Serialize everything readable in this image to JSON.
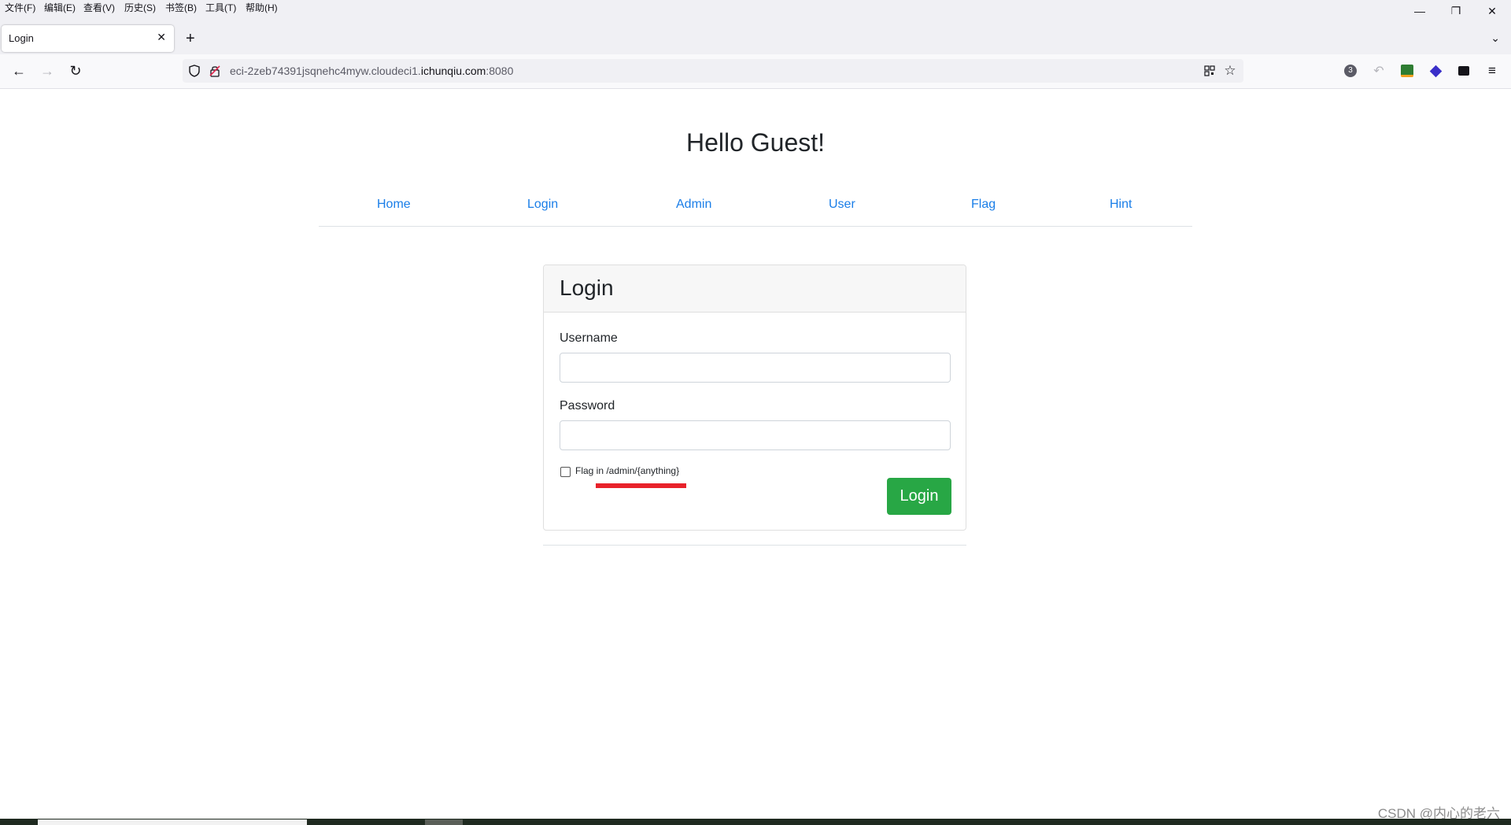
{
  "menubar": {
    "items": [
      "文件(F)",
      "编辑(E)",
      "查看(V)",
      "历史(S)",
      "书签(B)",
      "工具(T)",
      "帮助(H)"
    ]
  },
  "window_controls": {
    "minimize": "—",
    "restore": "❐",
    "close": "✕"
  },
  "tab": {
    "title": "Login",
    "close": "✕",
    "new_tab": "+",
    "list_tabs": "⌄"
  },
  "navigation": {
    "back": "←",
    "forward": "→",
    "reload": "↻",
    "url_prefix": "eci-2zeb74391jsqnehc4myw.cloudeci1.",
    "url_domain": "ichunqiu.com",
    "url_suffix": ":8080",
    "extensions_badge": "3"
  },
  "page": {
    "heading": "Hello Guest!",
    "nav": [
      "Home",
      "Login",
      "Admin",
      "User",
      "Flag",
      "Hint"
    ],
    "card": {
      "title": "Login",
      "username_label": "Username",
      "username_value": "",
      "password_label": "Password",
      "password_value": "",
      "checkbox_label": "Flag in /admin/{anything}",
      "checkbox_checked": false,
      "submit_label": "Login"
    }
  },
  "colors": {
    "link": "#1a7ee8",
    "submit_button": "#28a745",
    "annotation_underline": "#e8222a"
  },
  "watermark": "CSDN @内心的老六"
}
